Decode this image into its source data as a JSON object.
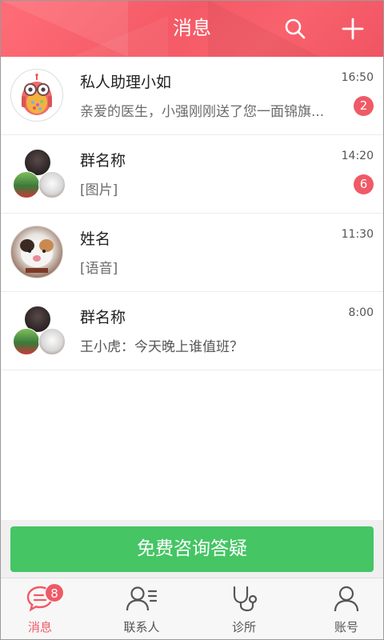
{
  "header": {
    "title": "消息",
    "search_icon": "search-icon",
    "add_icon": "plus-icon",
    "background": "#f45a66"
  },
  "conversations": [
    {
      "name": "私人助理小如",
      "time": "16:50",
      "preview": "亲爱的医生，小强刚刚送了您一面锦旗...",
      "badge": "2",
      "avatar": "owl-avatar"
    },
    {
      "name": "群名称",
      "time": "14:20",
      "preview": "[图片]",
      "badge": "6",
      "avatar": "group-avatar"
    },
    {
      "name": "姓名",
      "time": "11:30",
      "preview": "[语音]",
      "avatar": "cat-avatar"
    },
    {
      "name": "群名称",
      "time": "8:00",
      "preview": "王小虎：今天晚上谁值班？",
      "avatar": "group-avatar"
    }
  ],
  "consult_button": {
    "label": "免费咨询答疑",
    "color": "#45c564"
  },
  "tabbar": {
    "active_color": "#ef5a66",
    "tabs": [
      {
        "label": "消息",
        "icon": "chat-icon",
        "badge": "8",
        "active": true
      },
      {
        "label": "联系人",
        "icon": "contacts-icon"
      },
      {
        "label": "诊所",
        "icon": "stethoscope-icon"
      },
      {
        "label": "账号",
        "icon": "user-icon"
      }
    ]
  }
}
